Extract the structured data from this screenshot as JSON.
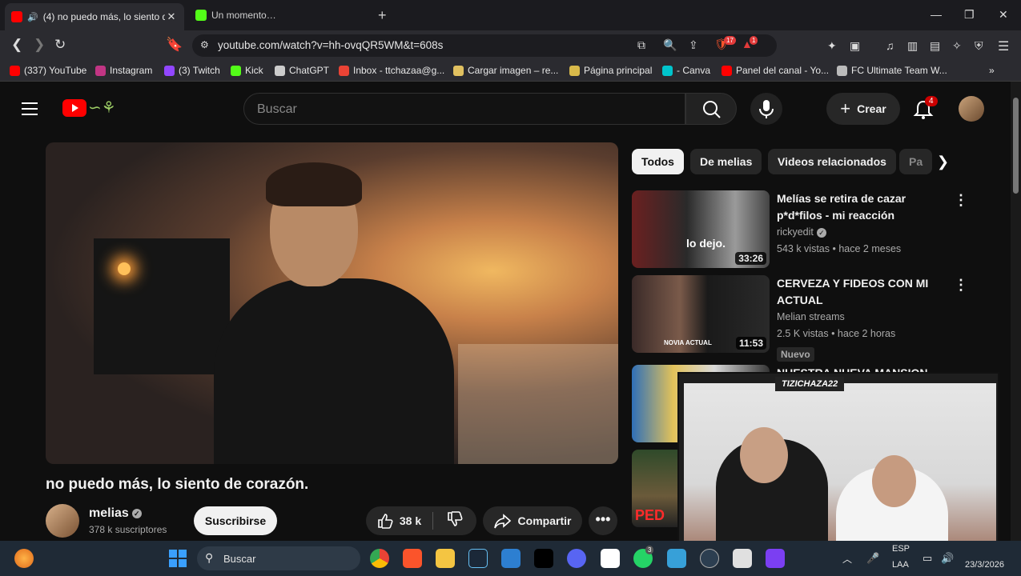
{
  "browser": {
    "tabs": [
      {
        "title": "(4) no puedo más, lo siento d",
        "close": "✕"
      },
      {
        "title": "Un momento…"
      }
    ],
    "new_tab": "+",
    "window_controls": {
      "minimize": "—",
      "maximize": "❐",
      "close": "✕"
    },
    "url": "youtube.com/watch?v=hh-ovqQR5WM&t=608s",
    "extension_badge_1": "17",
    "extension_badge_2": "1",
    "bookmarks": [
      {
        "label": "(337) YouTube",
        "color": "#ff0000"
      },
      {
        "label": "Instagram",
        "color": "#c13584"
      },
      {
        "label": "(3) Twitch",
        "color": "#9146ff"
      },
      {
        "label": "Kick",
        "color": "#53fc18"
      },
      {
        "label": "ChatGPT",
        "color": "#cccccc"
      },
      {
        "label": "Inbox - ttchazaa@g...",
        "color": "#ea4335"
      },
      {
        "label": "Cargar imagen – re...",
        "color": "#e0c060"
      },
      {
        "label": "Página principal",
        "color": "#d8b94a"
      },
      {
        "label": "- Canva",
        "color": "#00c4cc"
      },
      {
        "label": "Panel del canal - Yo...",
        "color": "#ff0000"
      },
      {
        "label": "FC Ultimate Team W...",
        "color": "#bbbbbb"
      }
    ]
  },
  "youtube": {
    "search_placeholder": "Buscar",
    "create_label": "Crear",
    "notifications_count": "4",
    "video_title": "no puedo más, lo siento de corazón.",
    "channel_name": "melias",
    "subscribers": "378 k suscriptores",
    "subscribe_label": "Suscribirse",
    "likes": "38 k",
    "share_label": "Compartir",
    "chips": [
      "Todos",
      "De melias",
      "Videos relacionados",
      "Pa"
    ],
    "recommendations": [
      {
        "title": "Melías se retira de cazar p*d*filos - mi reacción",
        "channel": "rickyedit",
        "verified": true,
        "meta": "543 k vistas • hace 2 meses",
        "duration": "33:26",
        "thumb_text": "lo dejo.",
        "badge": ""
      },
      {
        "title": "CERVEZA Y FIDEOS CON MI ACTUAL",
        "channel": "Melian streams",
        "verified": false,
        "meta": "2.5 K vistas • hace 2 horas",
        "duration": "11:53",
        "thumb_text": "NOVIA ACTUAL",
        "badge": "Nuevo"
      },
      {
        "title": "NUESTRA NUEVA MANSION",
        "channel": "",
        "verified": false,
        "meta": "",
        "duration": "",
        "thumb_text": "",
        "badge": ""
      },
      {
        "title": "",
        "channel": "",
        "verified": false,
        "meta": "",
        "duration": "",
        "thumb_text": "PED",
        "badge": ""
      }
    ],
    "pip_overlay_tag": "TIZICHAZA22"
  },
  "taskbar": {
    "search_placeholder": "Buscar",
    "whatsapp_badge": "3",
    "lang": "ESP",
    "lang2": "LAA",
    "time": "",
    "date": "23/3/2026"
  }
}
